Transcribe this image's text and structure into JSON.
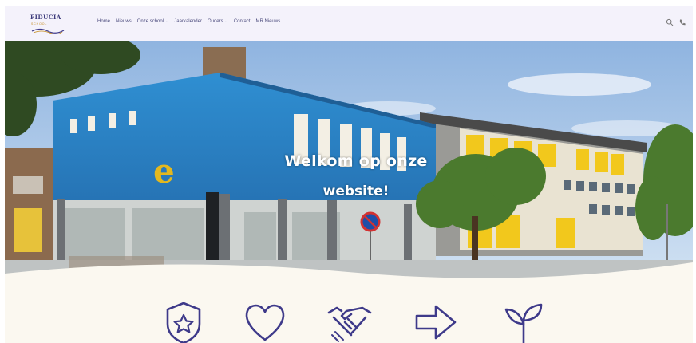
{
  "header": {
    "logo_text": "FIDUCIA",
    "logo_sub": "SCHOOL",
    "nav": [
      {
        "label": "Home",
        "has_dropdown": false
      },
      {
        "label": "Nieuws",
        "has_dropdown": false
      },
      {
        "label": "Onze school",
        "has_dropdown": true
      },
      {
        "label": "Jaarkalender",
        "has_dropdown": false
      },
      {
        "label": "Ouders",
        "has_dropdown": true
      },
      {
        "label": "Contact",
        "has_dropdown": false
      },
      {
        "label": "MR Nieuws",
        "has_dropdown": false
      }
    ],
    "caret": "⌄",
    "icons": [
      "search-icon",
      "phone-icon"
    ]
  },
  "hero": {
    "line1": "Welkom op onze",
    "line2": "website!"
  },
  "features": [
    "shield-star-icon",
    "heart-icon",
    "handshake-icon",
    "arrow-right-icon",
    "sprout-icon"
  ],
  "colors": {
    "header_bg": "#f4f2fb",
    "nav_text": "#4a4a7c",
    "brand_purple": "#3e3a8a",
    "building_blue": "#2e86c8",
    "building_yellow": "#f2c81c",
    "page_bg": "#fbf8f0"
  }
}
